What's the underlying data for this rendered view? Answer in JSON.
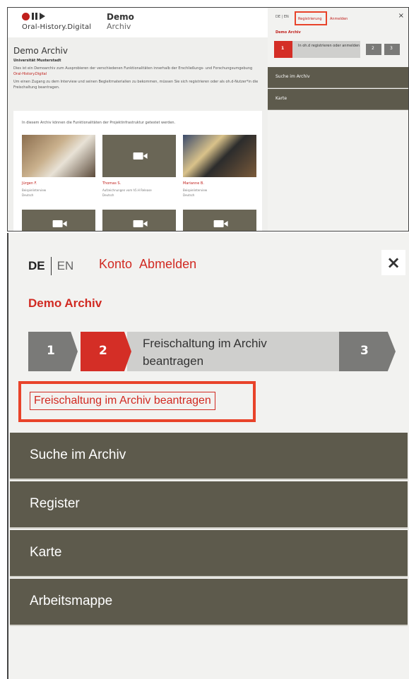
{
  "top": {
    "logo_text": "Oral-History.Digital",
    "app_title": "Demo",
    "app_subtitle": "Archiv",
    "intro_title": "Demo Archiv",
    "intro_university": "Universität Musterstadt",
    "intro_p1": "Dies ist ein Demoarchiv zum Ausprobieren der verschiedenen Funktionalitäten innerhalb der Erschließungs- und Forschungsumgebung ",
    "intro_p1_link": "Oral-History.Digital",
    "intro_p2": "Um einen Zugang zu dem Interview und seinen Begleitmaterialien zu bekommen, müssen Sie sich registrieren oder als oh.d-Nutzer*in die Freischaltung beantragen.",
    "cards_heading": "In diesem Archiv können die Funktionalitäten der Projektinfrastruktur getestet werden.",
    "cards": [
      {
        "name": "Jürgen F.",
        "meta1": "Beispielinterview",
        "meta2": "Deutsch"
      },
      {
        "name": "Thomas S.",
        "meta1": "Aufzeichnungen vom h5.H Release",
        "meta2": "Deutsch"
      },
      {
        "name": "Marianne B.",
        "meta1": "Beispielinterview",
        "meta2": "Deutsch"
      }
    ],
    "sidebar": {
      "lang": "DE | EN",
      "link1": "Registrierung",
      "link2": "Anmelden",
      "close": "×",
      "archiv": "Demo Archiv",
      "step1": "1",
      "step_label": "In oh.d registrieren oder anmelden",
      "step2": "2",
      "step3": "3",
      "nav": [
        "Suche im Archiv",
        "Karte"
      ]
    }
  },
  "bottom": {
    "lang_de": "DE",
    "lang_en": "EN",
    "account": "Konto",
    "logout": "Abmelden",
    "close": "×",
    "archive_name": "Demo Archiv",
    "steps": {
      "step1": "1",
      "step2": "2",
      "active_label": "Freischaltung im Archiv beantragen",
      "step3": "3"
    },
    "request_link": "Freischaltung im Archiv beantragen",
    "nav": [
      {
        "label": "Suche im Archiv"
      },
      {
        "label": "Register"
      },
      {
        "label": "Karte"
      },
      {
        "label": "Arbeitsmappe"
      }
    ]
  },
  "colors": {
    "accent_red": "#d12a22",
    "highlight_orange": "#e8432a",
    "nav_bg": "#5d5a4c",
    "step_grey": "#7a7a78"
  }
}
